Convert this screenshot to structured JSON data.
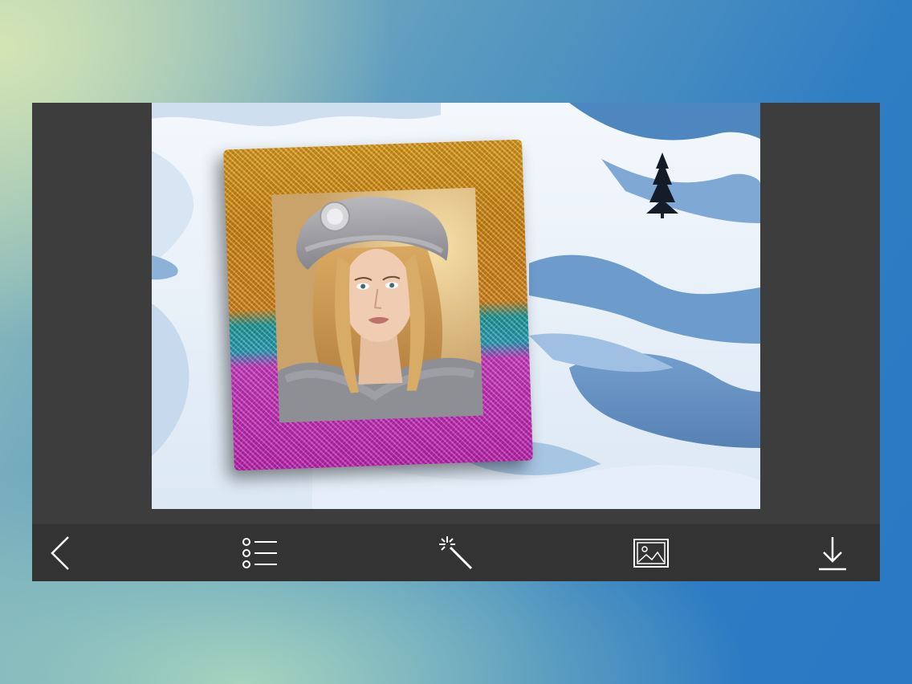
{
  "editor": {
    "background_scene": "snow-dunes-with-pine-tree",
    "frame_style": "rainbow-tinsel-frame",
    "frame_colors": [
      "#e7a21a",
      "#2aa5c0",
      "#c623b8"
    ]
  },
  "toolbar": {
    "items": [
      {
        "icon": "back-chevron-icon"
      },
      {
        "icon": "frame-list-icon"
      },
      {
        "icon": "magic-wand-icon"
      },
      {
        "icon": "gallery-image-icon"
      },
      {
        "icon": "download-icon"
      }
    ],
    "icon_color": "#ffffff"
  },
  "colors": {
    "panel": "#3d3d3d",
    "toolbar": "#333333"
  }
}
